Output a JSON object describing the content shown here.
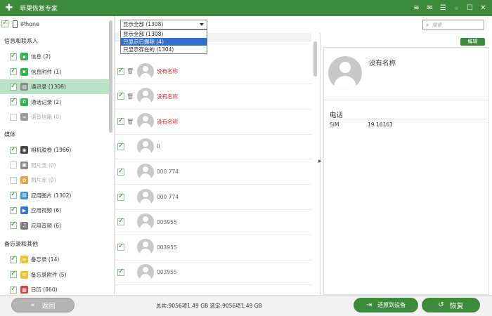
{
  "app": {
    "title": "苹果恢复专家",
    "logo_icon": "plus-cross-icon",
    "window_buttons": [
      "wifi-icon",
      "message-icon",
      "menu-icon",
      "minimize-icon",
      "maximize-icon",
      "close-icon"
    ]
  },
  "sidebar": {
    "device": "iPhone",
    "sections": [
      {
        "title": "信息和联系人",
        "items": [
          {
            "label": "信息 (2)",
            "checked": true,
            "icon": "message-icon",
            "color": "#2fb24b"
          },
          {
            "label": "信息附件 (1)",
            "checked": true,
            "icon": "message-attachment-icon",
            "color": "#2fb24b"
          },
          {
            "label": "通讯录 (1308)",
            "checked": true,
            "icon": "contacts-icon",
            "color": "#8a8a8a",
            "selected": true
          },
          {
            "label": "通话记录 (2)",
            "checked": true,
            "icon": "phone-icon",
            "color": "#2fb24b"
          },
          {
            "label": "语音信箱 (0)",
            "checked": false,
            "icon": "voicemail-icon",
            "color": "#9a9a9a",
            "disabled": true
          }
        ]
      },
      {
        "title": "媒体",
        "items": [
          {
            "label": "相机胶卷 (1966)",
            "checked": true,
            "icon": "camera-icon",
            "color": "#444444"
          },
          {
            "label": "照片流 (0)",
            "checked": false,
            "icon": "photo-stream-icon",
            "color": "#8a8a8a",
            "disabled": true
          },
          {
            "label": "照片库 (0)",
            "checked": false,
            "icon": "photo-library-icon",
            "color": "#e8a040",
            "disabled": true
          },
          {
            "label": "应用图片 (1302)",
            "checked": true,
            "icon": "app-photos-icon",
            "color": "#3a8fd8"
          },
          {
            "label": "应用视频 (6)",
            "checked": true,
            "icon": "app-video-icon",
            "color": "#3a6fd8"
          },
          {
            "label": "应用音频 (6)",
            "checked": true,
            "icon": "app-audio-icon",
            "color": "#7a7a7a"
          }
        ]
      },
      {
        "title": "备忘录和其他",
        "items": [
          {
            "label": "备忘录 (14)",
            "checked": true,
            "icon": "notes-icon",
            "color": "#f2c230"
          },
          {
            "label": "备忘录附件 (5)",
            "checked": true,
            "icon": "notes-attachment-icon",
            "color": "#f2c230"
          },
          {
            "label": "日历 (860)",
            "checked": true,
            "icon": "calendar-icon",
            "color": "#e04040"
          }
        ]
      }
    ]
  },
  "filter": {
    "selected": "显示全部 (1308)",
    "options": [
      "显示全部 (1308)",
      "只显示已删除 (4)",
      "只显示存在的 (1304)"
    ],
    "highlighted_index": 1
  },
  "contacts": [
    {
      "name": "没有名称",
      "deleted": true,
      "checked": true
    },
    {
      "name": "没有名称",
      "deleted": true,
      "checked": true
    },
    {
      "name": "没有名称",
      "deleted": true,
      "checked": true
    },
    {
      "name": "0",
      "deleted": false,
      "checked": true
    },
    {
      "name": "000 774",
      "deleted": false,
      "checked": true
    },
    {
      "name": "000 774",
      "deleted": false,
      "checked": true
    },
    {
      "name": "003955",
      "deleted": false,
      "checked": true
    },
    {
      "name": "003955",
      "deleted": false,
      "checked": true
    },
    {
      "name": "003955",
      "deleted": false,
      "checked": true
    }
  ],
  "search": {
    "placeholder": "搜索"
  },
  "detail": {
    "edit_label": "编辑",
    "name": "没有名称",
    "phone_section": "电话",
    "phone_type": "SIM",
    "phone_number": "19 16163"
  },
  "footer": {
    "back_label": "返回",
    "summary": "总共:9056项1.49 GB 选定:9056项1.49 GB",
    "restore_to_device_label": "还原到设备",
    "restore_label": "恢复"
  },
  "colors": {
    "accent": "#3c8a3c",
    "selected_row": "#b9e3c4",
    "deleted_text": "#e02020"
  }
}
